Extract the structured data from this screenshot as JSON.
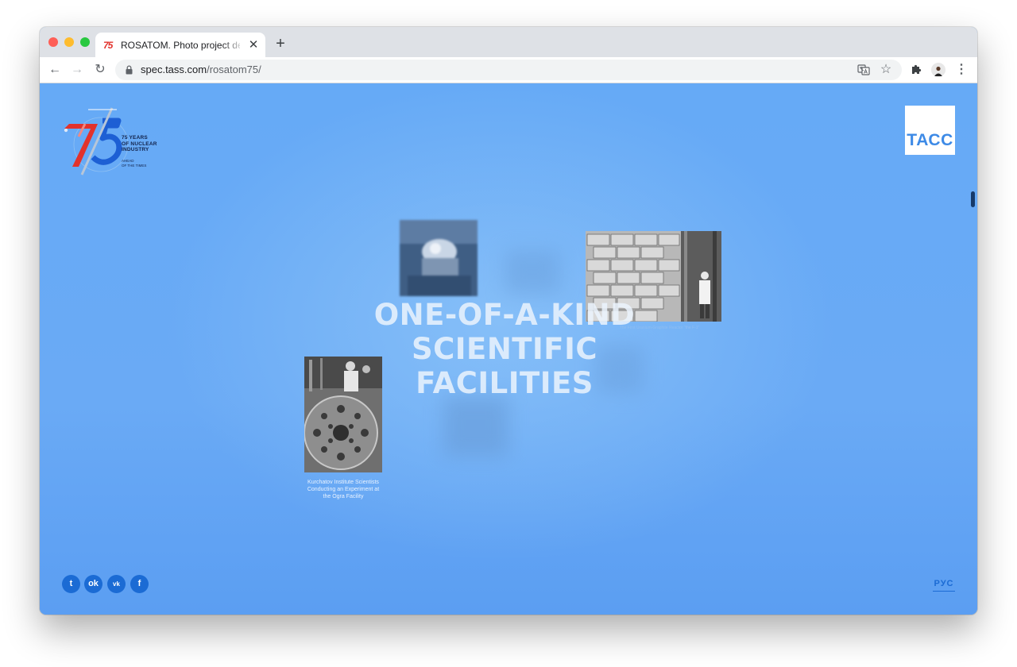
{
  "browser": {
    "tab": {
      "favicon": "75",
      "title": "ROSATOM. Photo project dedic",
      "close": "✕"
    },
    "new_tab": "+",
    "nav": {
      "back": "←",
      "forward": "→",
      "reload": "↻"
    },
    "address": {
      "host": "spec.tass.com",
      "path": "/rosatom75/"
    },
    "icons": [
      "translate-icon",
      "star-icon",
      "extensions-icon",
      "profile-icon",
      "menu-icon"
    ],
    "menu_glyph": "⋮",
    "star_glyph": "☆"
  },
  "page": {
    "logo": {
      "line1": "75 YEARS",
      "line2": "OF NUCLEAR",
      "line3": "INDUSTRY",
      "sub1": "AHEAD",
      "sub2": "OF THE TIMES"
    },
    "tass_logo": "ТАСС",
    "headline": [
      "ONE-OF-A-KIND",
      "SCIENTIFIC",
      "FACILITIES"
    ],
    "photos": [
      {
        "caption": "Kurchatov Institute Scientists Conducting an Experiment at the Ogra Facility"
      },
      {
        "caption": "The First Uranium-Graphite Reactor \"the F-1\""
      }
    ],
    "social": [
      "twitter-icon",
      "odnoklassniki-icon",
      "vk-icon",
      "facebook-icon"
    ],
    "social_glyphs": {
      "twitter": "t",
      "ok": "ok",
      "vk": "vk",
      "facebook": "f"
    },
    "language_switch": "РУС"
  },
  "colors": {
    "page_background": "#66aaf6",
    "accent": "#1b6bd4",
    "tass_blue": "#3d8ae6"
  }
}
